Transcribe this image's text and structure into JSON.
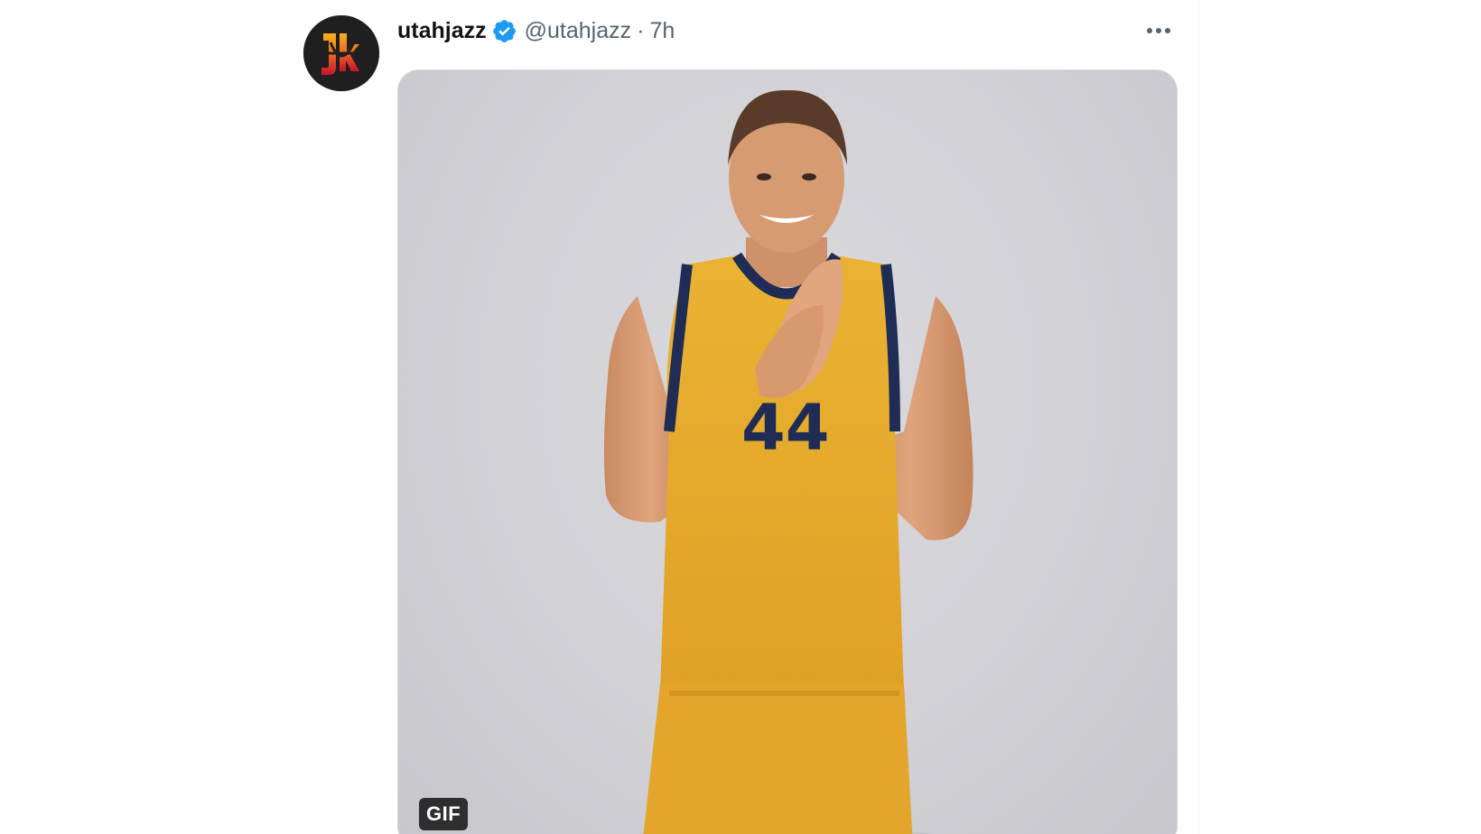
{
  "tweet": {
    "display_name": "utahjazz",
    "verified": true,
    "handle": "@utahjazz",
    "separator": "·",
    "timestamp": "7h",
    "more_icon": "ellipsis-icon",
    "avatar_icon": "utah-jazz-logo",
    "media": {
      "kind": "animated gif",
      "badge_label": "GIF"
    }
  },
  "colors": {
    "text_primary": "#0f1419",
    "text_secondary": "#536471",
    "verified_blue": "#1d9bf0",
    "border": "#cfd9de",
    "jersey_yellow": "#e8a92e",
    "jersey_trim_navy": "#1f2c55"
  }
}
